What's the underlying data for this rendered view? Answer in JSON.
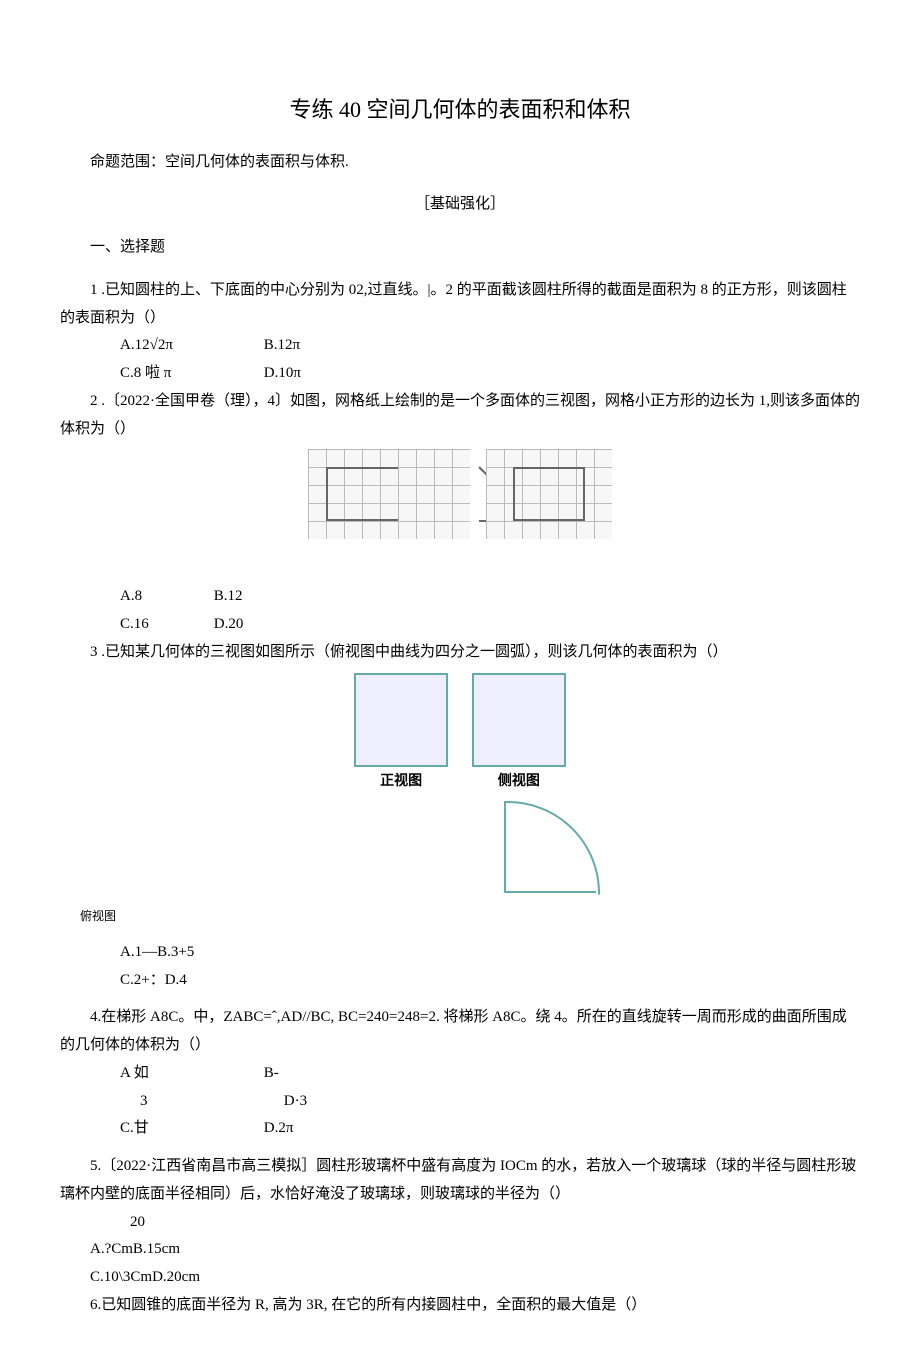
{
  "title": "专练 40 空间几何体的表面积和体积",
  "scope": "命题范围：空间几何体的表面积与体积.",
  "subhead": "［基础强化］",
  "sec1": "一、选择题",
  "q1": {
    "text": "1 .已知圆柱的上、下底面的中心分别为 02,过直线。|。2 的平面截该圆柱所得的截面是面积为 8 的正方形，则该圆柱的表面积为（）",
    "A": "A.12√2π",
    "B": "B.12π",
    "C": "C.8 啦 π",
    "D": "D.10π"
  },
  "q2": {
    "text": "2 .〔2022·全国甲卷（理），4〕如图，网格纸上绘制的是一个多面体的三视图，网格小正方形的边长为 1,则该多面体的体积为（）",
    "A": "A.8",
    "B": "B.12",
    "C": "C.16",
    "D": "D.20"
  },
  "q3": {
    "text": "3 .已知某几何体的三视图如图所示（俯视图中曲线为四分之一圆弧），则该几何体的表面积为（）",
    "front": "正视图",
    "side": "侧视图",
    "top": "俯视图",
    "A": "A.1—B.3+5",
    "C": "C.2+：D.4"
  },
  "q4": {
    "text": "4.在梯形 A8C。中，ZABC=ˆ,AD//BC, BC=240=248=2. 将梯形 A8C。绕 4。所在的直线旋转一周而形成的曲面所围成的几何体的体积为（）",
    "A": "A 如",
    "B": "B-",
    "A2": "3",
    "B2": "D·3",
    "C": "C.甘",
    "D": "D.2π"
  },
  "q5": {
    "text": "5.〔2022·江西省南昌市高三模拟］圆柱形玻璃杯中盛有高度为 IOCm 的水，若放入一个玻璃球（球的半径与圆柱形玻璃杯内壁的底面半径相同）后，水恰好淹没了玻璃球，则玻璃球的半径为（）",
    "pre": "20",
    "A": "A.?CmB.15cm",
    "C": "C.10\\3CmD.20cm"
  },
  "q6": {
    "text": "6.已知圆锥的底面半径为 R, 高为 3R, 在它的所有内接圆柱中，全面积的最大值是（）"
  }
}
